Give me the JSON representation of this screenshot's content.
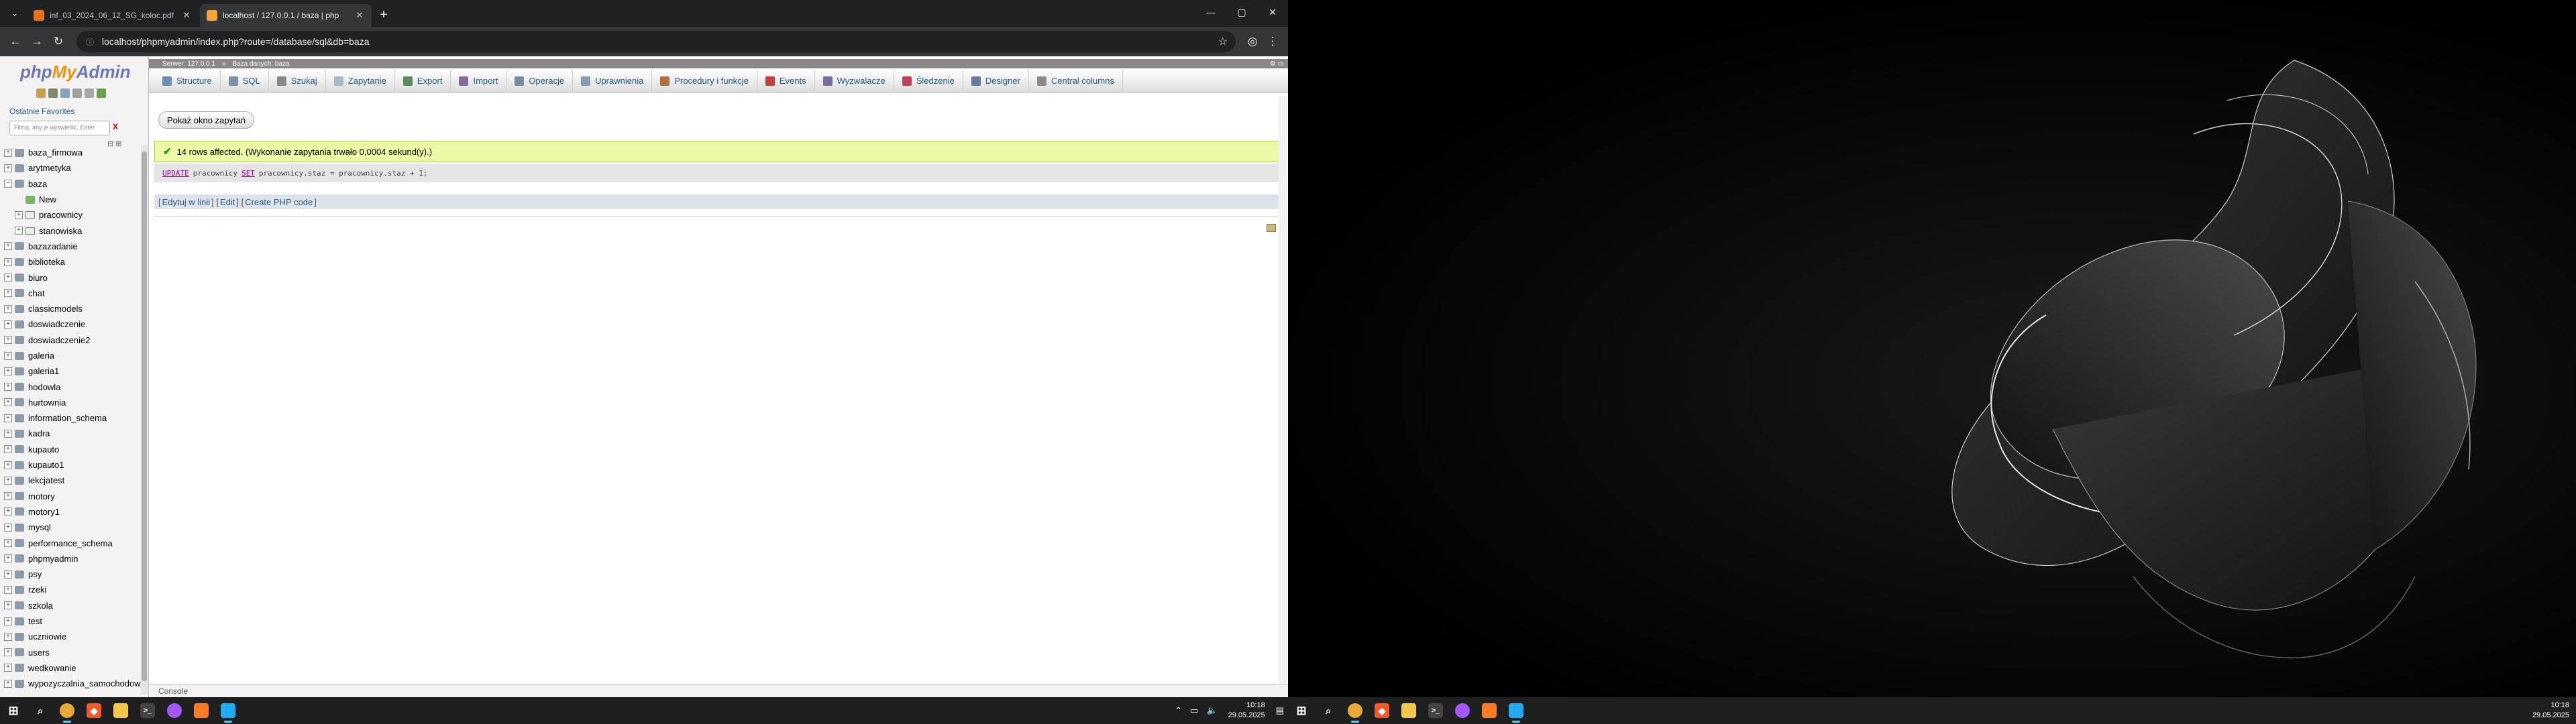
{
  "browser": {
    "tabs": [
      {
        "title": "inf_03_2024_06_12_SG_koloc.pdf",
        "active": false
      },
      {
        "title": "localhost / 127.0.0.1 / baza | php",
        "active": true
      }
    ],
    "url": "localhost/phpmyadmin/index.php?route=/database/sql&db=baza",
    "window_controls": {
      "minimize": "—",
      "maximize": "▢",
      "close": "✕"
    }
  },
  "pma": {
    "logo": {
      "php": "php",
      "my": "My",
      "admin": "Admin"
    },
    "nav_links": "Ostatnie  Favorites",
    "filter_placeholder": "Filtruj, aby je wyświetlić, Enter",
    "filter_clear": "X",
    "databases": [
      {
        "name": "baza_firmowa",
        "level": 0
      },
      {
        "name": "arytmetyka",
        "level": 0
      },
      {
        "name": "baza",
        "level": 0,
        "expanded": true
      },
      {
        "name": "New",
        "level": 1,
        "kind": "new"
      },
      {
        "name": "pracownicy",
        "level": 1,
        "kind": "table"
      },
      {
        "name": "stanowiska",
        "level": 1,
        "kind": "table"
      },
      {
        "name": "bazazadanie",
        "level": 0
      },
      {
        "name": "biblioteka",
        "level": 0
      },
      {
        "name": "biuro",
        "level": 0
      },
      {
        "name": "chat",
        "level": 0
      },
      {
        "name": "classicmodels",
        "level": 0
      },
      {
        "name": "doswiadczenie",
        "level": 0
      },
      {
        "name": "doswiadczenie2",
        "level": 0
      },
      {
        "name": "galeria",
        "level": 0
      },
      {
        "name": "galeria1",
        "level": 0
      },
      {
        "name": "hodowla",
        "level": 0
      },
      {
        "name": "hurtownia",
        "level": 0
      },
      {
        "name": "information_schema",
        "level": 0
      },
      {
        "name": "kadra",
        "level": 0
      },
      {
        "name": "kupauto",
        "level": 0
      },
      {
        "name": "kupauto1",
        "level": 0
      },
      {
        "name": "lekcjatest",
        "level": 0
      },
      {
        "name": "motory",
        "level": 0
      },
      {
        "name": "motory1",
        "level": 0
      },
      {
        "name": "mysql",
        "level": 0
      },
      {
        "name": "performance_schema",
        "level": 0
      },
      {
        "name": "phpmyadmin",
        "level": 0
      },
      {
        "name": "psy",
        "level": 0
      },
      {
        "name": "rzeki",
        "level": 0
      },
      {
        "name": "szkola",
        "level": 0
      },
      {
        "name": "test",
        "level": 0
      },
      {
        "name": "uczniowie",
        "level": 0
      },
      {
        "name": "users",
        "level": 0
      },
      {
        "name": "wedkowanie",
        "level": 0
      },
      {
        "name": "wypozyczalnia_samochodow",
        "level": 0
      }
    ],
    "breadcrumb": {
      "server": "Serwer: 127.0.0.1",
      "database": "Baza danych: baza"
    },
    "menu": [
      {
        "label": "Structure",
        "icon": "structure-icon",
        "color": "#6d8fb3"
      },
      {
        "label": "SQL",
        "icon": "sql-icon",
        "color": "#7b8fa6"
      },
      {
        "label": "Szukaj",
        "icon": "search-icon",
        "color": "#888888"
      },
      {
        "label": "Zapytanie",
        "icon": "query-icon",
        "color": "#a9b7c6"
      },
      {
        "label": "Export",
        "icon": "export-icon",
        "color": "#5c8a5c"
      },
      {
        "label": "Import",
        "icon": "import-icon",
        "color": "#8a6a9a"
      },
      {
        "label": "Operacje",
        "icon": "operations-icon",
        "color": "#7a8aa0"
      },
      {
        "label": "Uprawnienia",
        "icon": "privileges-icon",
        "color": "#8a9ab0"
      },
      {
        "label": "Procedury i funkcje",
        "icon": "routines-icon",
        "color": "#b07040"
      },
      {
        "label": "Events",
        "icon": "events-icon",
        "color": "#c04040"
      },
      {
        "label": "Wyzwalacze",
        "icon": "triggers-icon",
        "color": "#7a6aa0"
      },
      {
        "label": "Śledzenie",
        "icon": "tracking-icon",
        "color": "#c04060"
      },
      {
        "label": "Designer",
        "icon": "designer-icon",
        "color": "#6a7a9a"
      },
      {
        "label": "Central columns",
        "icon": "central-columns-icon",
        "color": "#8a8a8a"
      }
    ],
    "show_query_button": "Pokaż okno zapytań",
    "success_message": "14 rows affected. (Wykonanie zapytania trwało 0,0004 sekund(y).)",
    "sql": {
      "update": "UPDATE",
      "table": "pracownicy",
      "set": "SET",
      "rest": "pracownicy.staz = pracownicy.staz + 1;"
    },
    "sql_links": {
      "edit_inline": "Edytuj w linii",
      "edit": "Edit",
      "create_php": "Create PHP code"
    },
    "console": "Console"
  },
  "taskbar_left": {
    "icons": [
      "windows-start-icon",
      "search-icon",
      "chrome-icon",
      "brave-icon",
      "file-explorer-icon",
      "terminal-icon",
      "figma-icon",
      "xampp-icon",
      "vscode-icon"
    ],
    "time": "10:18",
    "date": "29.05.2025"
  },
  "taskbar_right": {
    "time": "10:18",
    "date": "29.05.2025"
  },
  "colors": {
    "success_bg": "#ebf8a4",
    "link": "#235a81",
    "taskbar": "#1f1f1f"
  }
}
